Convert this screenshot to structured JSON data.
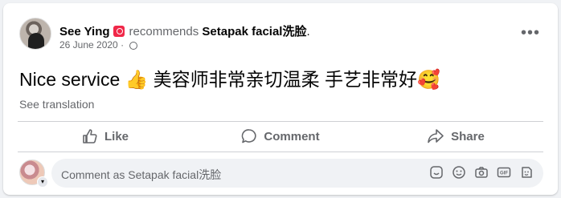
{
  "post": {
    "author": "See Ying",
    "verb": "recommends",
    "page": "Setapak facial洗脸",
    "period": ".",
    "date": "26 June 2020",
    "dot": "·",
    "text": "Nice service 👍 美容师非常亲切温柔 手艺非常好🥰",
    "see_translation": "See translation"
  },
  "actions": {
    "like": "Like",
    "comment": "Comment",
    "share": "Share"
  },
  "composer": {
    "placeholder": "Comment as Setapak facial洗脸"
  },
  "icons": {
    "menu": "more-options-icon",
    "privacy": "globe-icon",
    "composer": [
      "sticker-icon",
      "emoji-icon",
      "camera-icon",
      "gif-icon",
      "avatar-sticker-icon"
    ]
  },
  "colors": {
    "text": "#050505",
    "secondary": "#65676b",
    "badge": "#f02849",
    "background": "#f0f2f5"
  }
}
